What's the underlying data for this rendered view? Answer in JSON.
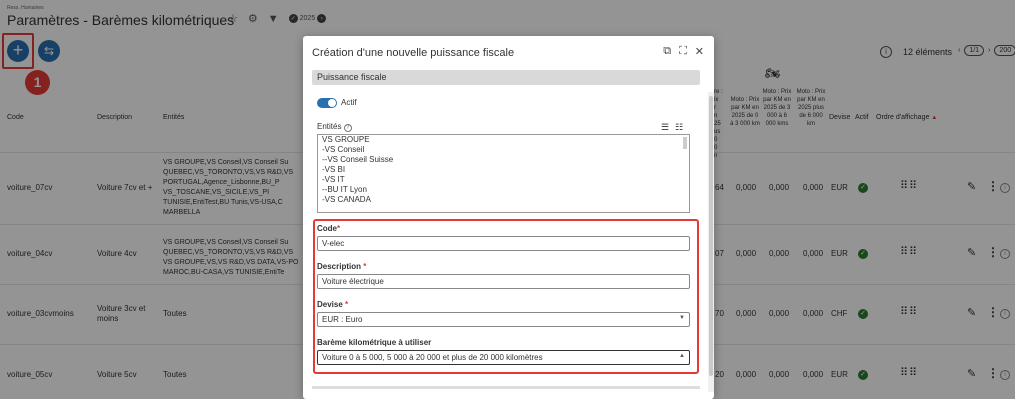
{
  "header": {
    "breadcrumb": "Ress. Humaines",
    "title": "Paramètres - Barèmes kilométriques",
    "year": "2025"
  },
  "toolbar": {
    "add_label": "+",
    "callout": "1",
    "count": "12 éléments",
    "page": "1/1",
    "page_size": "200"
  },
  "table": {
    "columns": [
      "Code",
      "Description",
      "Entités"
    ],
    "right_columns": [
      "Moto : Prix par KM en 2025 de 0 à 3 000 km",
      "Moto : Prix par KM en 2025 de 3 000 à 6 000 kms",
      "Moto : Prix par KM en 2025 plus de 6 000 km",
      "Devise",
      "Actif",
      "Ordre d'affichage"
    ],
    "partial_heads": [
      "re :",
      "ix",
      "r",
      "n",
      "25",
      "us",
      "0",
      "0",
      "n"
    ],
    "rows": [
      {
        "code": "voiture_07cv",
        "description": "Voiture 7cv et +",
        "entities": [
          "VS GROUPE,VS Conseil,VS Conseil Su",
          "QUEBEC,VS_TORONTO,VS,VS R&D,VS",
          "PORTUGAL,Agence_Lisbonne,BU_P",
          "VS_TOSCANE,VS_SICILE,VS_PI",
          "TUNISIE,EntiTest,BU Tunis,VS-USA,C",
          "MARBELLA"
        ],
        "partial": "64",
        "v1": "0,000",
        "v2": "0,000",
        "v3": "0,000",
        "currency": "EUR"
      },
      {
        "code": "voiture_04cv",
        "description": "Voiture 4cv",
        "entities": [
          "VS GROUPE,VS Conseil,VS Conseil Su",
          "QUEBEC,VS_TORONTO,VS,VS R&D,VS",
          "VS GROUPE,VS,VS R&D,VS DATA,VS-PO",
          "MAROC,BU-CASA,VS TUNISIE,EntiTe"
        ],
        "partial": "07",
        "v1": "0,000",
        "v2": "0,000",
        "v3": "0,000",
        "currency": "EUR"
      },
      {
        "code": "voiture_03cvmoins",
        "description": "Voiture 3cv et moins",
        "entities": [
          "Toutes"
        ],
        "partial": "70",
        "v1": "0,000",
        "v2": "0,000",
        "v3": "0,000",
        "currency": "CHF"
      },
      {
        "code": "voiture_05cv",
        "description": "Voiture 5cv",
        "entities": [
          "Toutes"
        ],
        "partial": "20",
        "v1": "0,000",
        "v2": "0,000",
        "v3": "0,000",
        "currency": "EUR"
      }
    ]
  },
  "modal": {
    "title": "Création d'une nouvelle puissance fiscale",
    "section": "Puissance fiscale",
    "actif_label": "Actif",
    "entities_label": "Entités",
    "entities_options": [
      "VS GROUPE",
      "-VS Conseil",
      "--VS Conseil Suisse",
      "-VS BI",
      "-VS IT",
      "--BU IT Lyon",
      "-VS CANADA"
    ],
    "code_label": "Code",
    "code_value": "V-elec",
    "description_label": "Description",
    "description_value": "Voiture électrique",
    "devise_label": "Devise",
    "devise_value": "EUR : Euro",
    "bareme_label": "Barème kilométrique à utiliser",
    "bareme_value": "Voiture 0 à 5 000, 5 000 à 20 000 et plus de 20 000 kilomètres"
  },
  "colors": {
    "accent": "#2a6fb0",
    "highlight": "#e53935",
    "active": "#2e7d32"
  }
}
